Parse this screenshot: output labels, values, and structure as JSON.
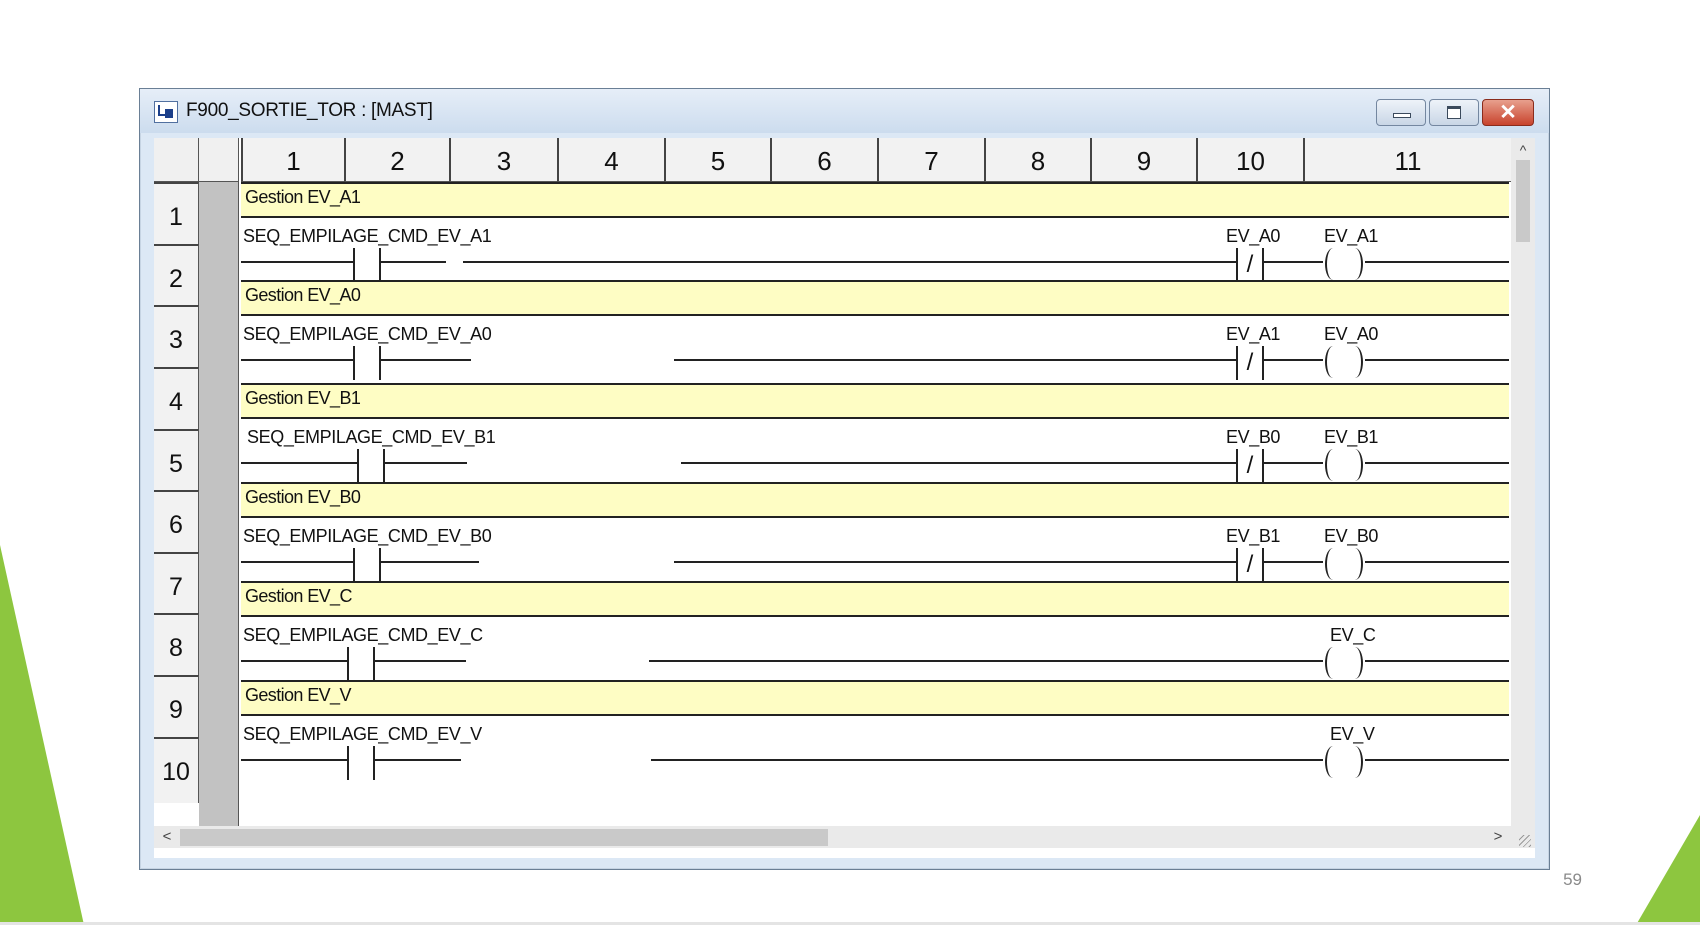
{
  "window": {
    "title": "F900_SORTIE_TOR : [MAST]",
    "close_symbol": "✕",
    "scroll_up_symbol": "^",
    "scroll_left_symbol": "<",
    "scroll_right_symbol": ">"
  },
  "columns": [
    "1",
    "2",
    "3",
    "4",
    "5",
    "6",
    "7",
    "8",
    "9",
    "10",
    "11"
  ],
  "rows": [
    "1",
    "2",
    "3",
    "4",
    "5",
    "6",
    "7",
    "8",
    "9",
    "10"
  ],
  "rungs": [
    {
      "comment": "Gestion EV_A1",
      "contact": "SEQ_EMPILAGE_CMD_EV_A1",
      "interlock": "EV_A0",
      "coil": "EV_A1"
    },
    {
      "comment": "Gestion EV_A0",
      "contact": "SEQ_EMPILAGE_CMD_EV_A0",
      "interlock": "EV_A1",
      "coil": "EV_A0"
    },
    {
      "comment": "Gestion EV_B1",
      "contact": "SEQ_EMPILAGE_CMD_EV_B1",
      "interlock": "EV_B0",
      "coil": "EV_B1"
    },
    {
      "comment": "Gestion EV_B0",
      "contact": "SEQ_EMPILAGE_CMD_EV_B0",
      "interlock": "EV_B1",
      "coil": "EV_B0"
    },
    {
      "comment": "Gestion EV_C",
      "contact": "SEQ_EMPILAGE_CMD_EV_C",
      "coil": "EV_C"
    },
    {
      "comment": "Gestion EV_V",
      "contact": "SEQ_EMPILAGE_CMD_EV_V",
      "coil": "EV_V"
    }
  ],
  "negated_contact_symbol": "/",
  "page_number": "59",
  "colors": {
    "comment_background": "#fefdc4",
    "slide_accent_green": "#8dc63f",
    "window_frame": "#dce8f5",
    "close_button": "#c8432c"
  }
}
